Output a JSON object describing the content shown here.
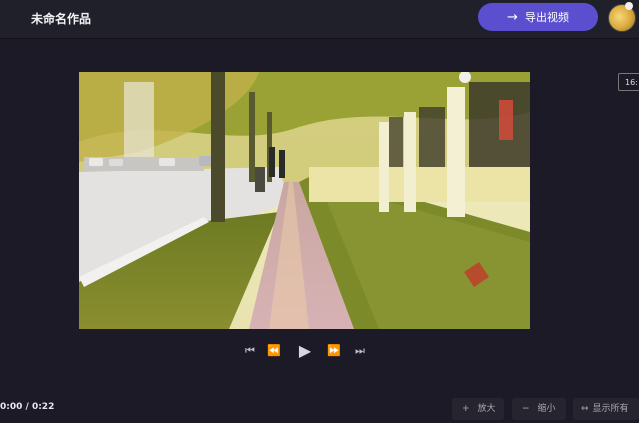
{
  "header": {
    "title": "未命名作品",
    "export_label": "导出视频",
    "export_icon": "arrow-right-icon"
  },
  "ratio": {
    "label": "16:"
  },
  "player": {
    "controls": [
      {
        "name": "skip-back-button",
        "glyph": "⏮"
      },
      {
        "name": "rewind-button",
        "glyph": "⏪"
      },
      {
        "name": "play-button",
        "glyph": "▶"
      },
      {
        "name": "fast-forward-button",
        "glyph": "⏩"
      },
      {
        "name": "skip-forward-button",
        "glyph": "⏭"
      }
    ],
    "time": "0:00 / 0:22"
  },
  "timeline_tools": {
    "zoom_in": {
      "symbol": "+",
      "label": "放大"
    },
    "zoom_out": {
      "symbol": "−",
      "label": "缩小"
    },
    "show_all": {
      "symbol": "↔",
      "label": "显示所有"
    }
  },
  "colors": {
    "accent": "#5b4fd0",
    "background": "#1b1a26",
    "topbar": "#20202b"
  }
}
